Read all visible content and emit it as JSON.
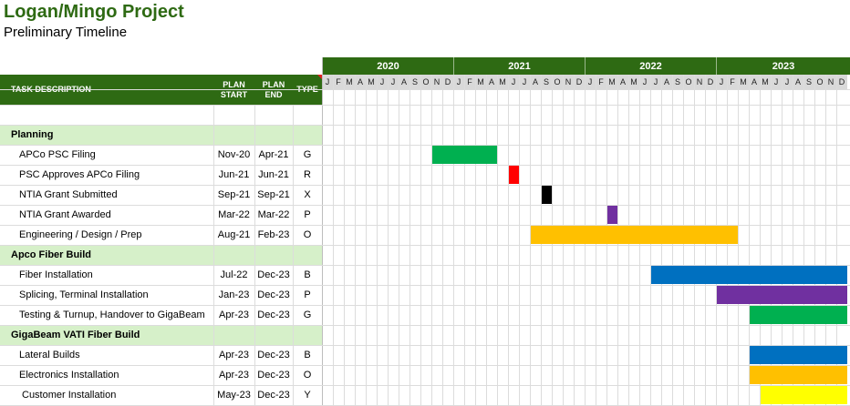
{
  "title": "Logan/Mingo Project",
  "subtitle": "Preliminary Timeline",
  "headers": {
    "task": "TASK DESCRIPTION",
    "start": "PLAN START",
    "end": "PLAN END",
    "type": "TYPE"
  },
  "years": [
    "2020",
    "2021",
    "2022",
    "2023"
  ],
  "month_letters": [
    "J",
    "F",
    "M",
    "A",
    "M",
    "J",
    "J",
    "A",
    "S",
    "O",
    "N",
    "D"
  ],
  "colors": {
    "header_green": "#2e6a13",
    "section_green": "#d6f0c9",
    "G": "#00b050",
    "R": "#ff0000",
    "X": "#000000",
    "P": "#7030a0",
    "O": "#ffc000",
    "B": "#0070c0",
    "Y": "#ffff00"
  },
  "rows": [
    {
      "kind": "blank"
    },
    {
      "kind": "section",
      "label": "Planning"
    },
    {
      "kind": "task",
      "label": "APCo PSC Filing",
      "start": "Nov-20",
      "end": "Apr-21",
      "type": "G"
    },
    {
      "kind": "task",
      "label": "PSC Approves APCo Filing",
      "start": "Jun-21",
      "end": "Jun-21",
      "type": "R"
    },
    {
      "kind": "task",
      "label": "NTIA Grant Submitted",
      "start": "Sep-21",
      "end": "Sep-21",
      "type": "X"
    },
    {
      "kind": "task",
      "label": "NTIA Grant Awarded",
      "start": "Mar-22",
      "end": "Mar-22",
      "type": "P"
    },
    {
      "kind": "task",
      "label": "Engineering / Design / Prep",
      "start": "Aug-21",
      "end": "Feb-23",
      "type": "O"
    },
    {
      "kind": "section",
      "label": "Apco Fiber Build"
    },
    {
      "kind": "task",
      "label": "Fiber Installation",
      "start": "Jul-22",
      "end": "Dec-23",
      "type": "B"
    },
    {
      "kind": "task",
      "label": "Splicing, Terminal Installation",
      "start": "Jan-23",
      "end": "Dec-23",
      "type": "P"
    },
    {
      "kind": "task",
      "label": "Testing & Turnup, Handover to GigaBeam",
      "start": "Apr-23",
      "end": "Dec-23",
      "type": "G"
    },
    {
      "kind": "section",
      "label": "GigaBeam VATI Fiber Build"
    },
    {
      "kind": "task",
      "label": "Lateral Builds",
      "start": "Apr-23",
      "end": "Dec-23",
      "type": "B"
    },
    {
      "kind": "task",
      "label": "Electronics Installation",
      "start": "Apr-23",
      "end": "Dec-23",
      "type": "O"
    },
    {
      "kind": "task",
      "label": "Customer Installation",
      "start": "May-23",
      "end": "Dec-23",
      "type": "Y"
    }
  ]
}
